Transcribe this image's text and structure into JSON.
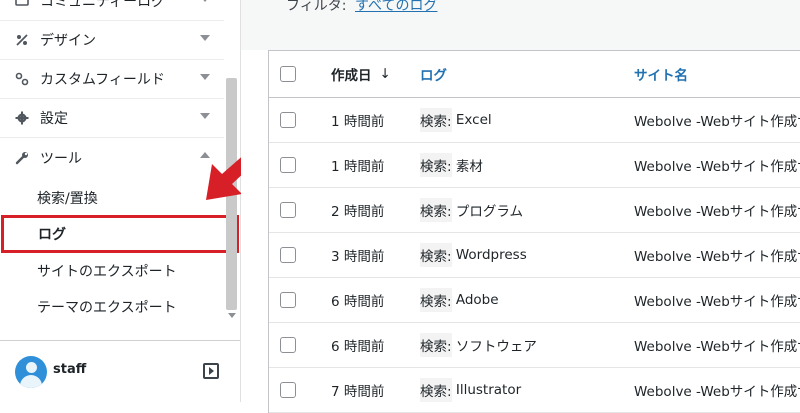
{
  "sidebar": {
    "items": [
      {
        "label": "コミュニティーログ",
        "icon": "community-icon"
      },
      {
        "label": "デザイン",
        "icon": "design-icon"
      },
      {
        "label": "カスタムフィールド",
        "icon": "custom-field-icon"
      },
      {
        "label": "設定",
        "icon": "settings-icon"
      },
      {
        "label": "ツール",
        "icon": "tools-icon"
      }
    ],
    "submenu": [
      {
        "label": "検索/置換"
      },
      {
        "label": "ログ"
      },
      {
        "label": "サイトのエクスポート"
      },
      {
        "label": "テーマのエクスポート"
      }
    ],
    "user": {
      "name": "staff"
    }
  },
  "filter": {
    "label": "フィルタ:",
    "link": "すべてのログ"
  },
  "table": {
    "headers": {
      "date": "作成日",
      "sort": "↓",
      "log": "ログ",
      "site": "サイト名"
    },
    "rows": [
      {
        "date": "1 時間前",
        "log_prefix": "検索:",
        "log_term": "Excel",
        "site": "Webolve -Webサイト作成サ"
      },
      {
        "date": "1 時間前",
        "log_prefix": "検索:",
        "log_term": "素材",
        "site": "Webolve -Webサイト作成サ"
      },
      {
        "date": "2 時間前",
        "log_prefix": "検索:",
        "log_term": "プログラム",
        "site": "Webolve -Webサイト作成サ"
      },
      {
        "date": "3 時間前",
        "log_prefix": "検索:",
        "log_term": "Wordpress",
        "site": "Webolve -Webサイト作成サ"
      },
      {
        "date": "6 時間前",
        "log_prefix": "検索:",
        "log_term": "Adobe",
        "site": "Webolve -Webサイト作成サ"
      },
      {
        "date": "6 時間前",
        "log_prefix": "検索:",
        "log_term": "ソフトウェア",
        "site": "Webolve -Webサイト作成サ"
      },
      {
        "date": "7 時間前",
        "log_prefix": "検索:",
        "log_term": "Illustrator",
        "site": "Webolve -Webサイト作成サ"
      }
    ]
  },
  "colors": {
    "accent": "#2271b1",
    "highlight": "#d61f26"
  }
}
